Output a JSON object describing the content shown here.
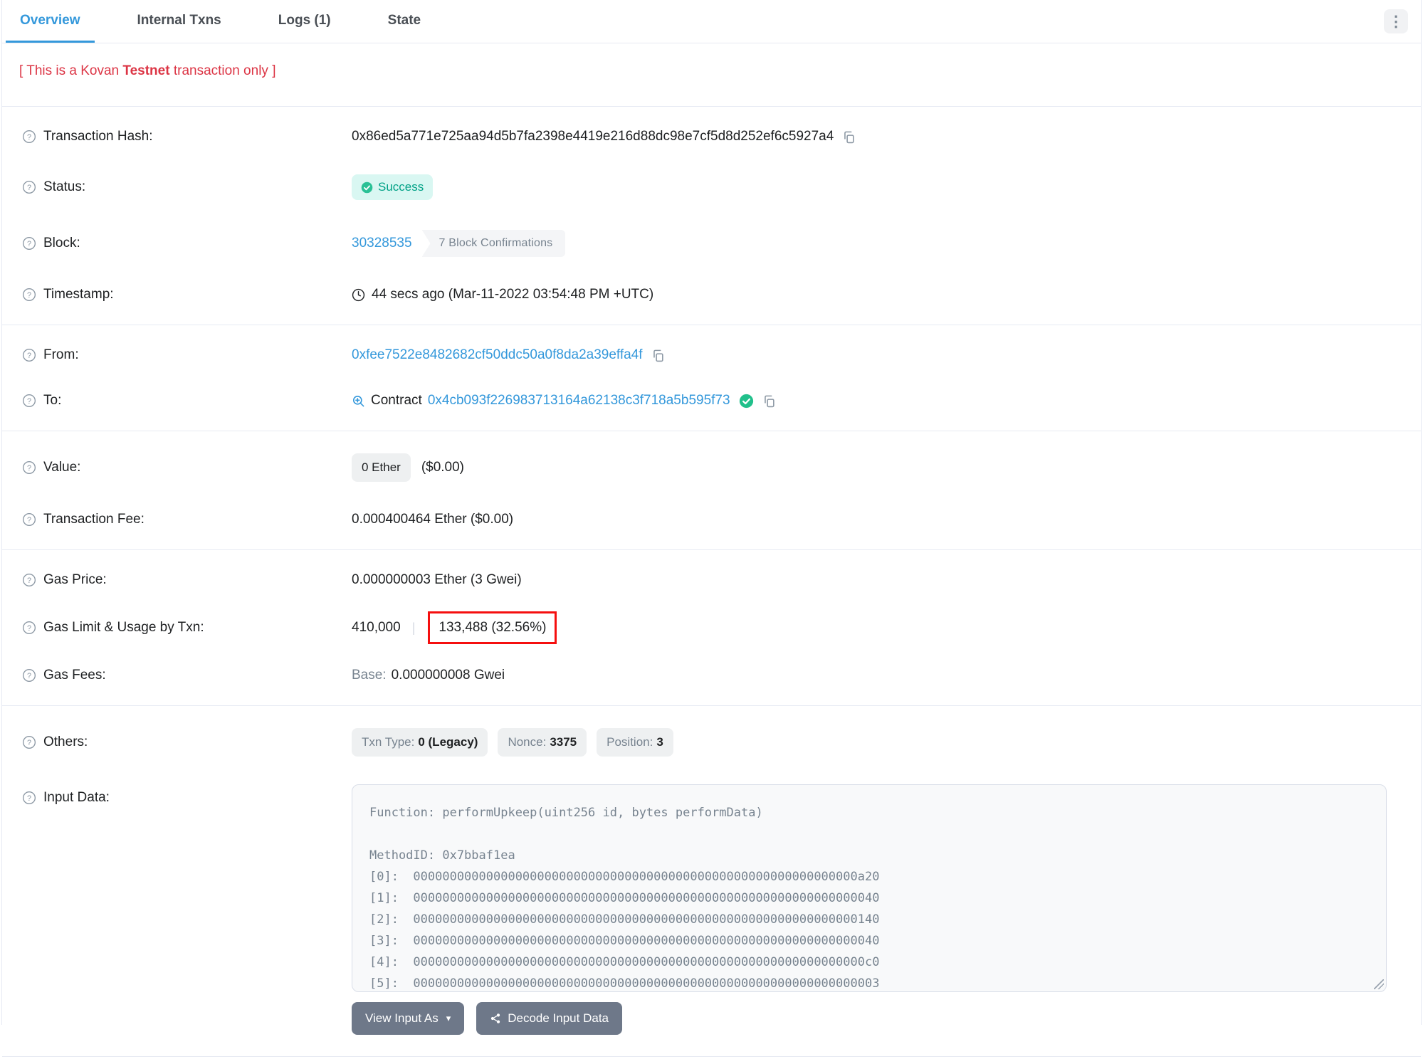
{
  "tabs": {
    "items": [
      {
        "label": "Overview",
        "active": true
      },
      {
        "label": "Internal Txns",
        "active": false
      },
      {
        "label": "Logs (1)",
        "active": false
      },
      {
        "label": "State",
        "active": false
      }
    ],
    "menu_glyph": "⋮"
  },
  "notice": {
    "prefix": "[ This is a Kovan ",
    "bold": "Testnet",
    "suffix": " transaction only ]"
  },
  "rows": {
    "transaction_hash": {
      "label": "Transaction Hash:",
      "value": "0x86ed5a771e725aa94d5b7fa2398e4419e216d88dc98e7cf5d8d252ef6c5927a4"
    },
    "status": {
      "label": "Status:",
      "value": "Success"
    },
    "block": {
      "label": "Block:",
      "number": "30328535",
      "confirmations": "7 Block Confirmations"
    },
    "timestamp": {
      "label": "Timestamp:",
      "value": "44 secs ago (Mar-11-2022 03:54:48 PM +UTC)"
    },
    "from": {
      "label": "From:",
      "address": "0xfee7522e8482682cf50ddc50a0f8da2a39effa4f"
    },
    "to": {
      "label": "To:",
      "type": "Contract",
      "address": "0x4cb093f226983713164a62138c3f718a5b595f73"
    },
    "value": {
      "label": "Value:",
      "amount": "0 Ether",
      "usd": "($0.00)"
    },
    "transaction_fee": {
      "label": "Transaction Fee:",
      "value": "0.000400464 Ether ($0.00)"
    },
    "gas_price": {
      "label": "Gas Price:",
      "value": "0.000000003 Ether (3 Gwei)"
    },
    "gas_limit_usage": {
      "label": "Gas Limit & Usage by Txn:",
      "limit": "410,000",
      "separator": "|",
      "usage": "133,488 (32.56%)"
    },
    "gas_fees": {
      "label": "Gas Fees:",
      "base_label": "Base:",
      "base_value": "0.000000008 Gwei"
    },
    "others": {
      "label": "Others:",
      "badges": [
        {
          "label": "Txn Type:",
          "value": "0 (Legacy)"
        },
        {
          "label": "Nonce:",
          "value": "3375"
        },
        {
          "label": "Position:",
          "value": "3"
        }
      ]
    },
    "input_data": {
      "label": "Input Data:",
      "lines": [
        "Function: performUpkeep(uint256 id, bytes performData)",
        "",
        "MethodID: 0x7bbaf1ea",
        "[0]:  0000000000000000000000000000000000000000000000000000000000000a20",
        "[1]:  0000000000000000000000000000000000000000000000000000000000000040",
        "[2]:  0000000000000000000000000000000000000000000000000000000000000140",
        "[3]:  0000000000000000000000000000000000000000000000000000000000000040",
        "[4]:  00000000000000000000000000000000000000000000000000000000000000c0",
        "[5]:  0000000000000000000000000000000000000000000000000000000000000003"
      ]
    }
  },
  "buttons": {
    "view_input_as": "View Input As",
    "caret_glyph": "▾",
    "decode_input_data": "Decode Input Data"
  },
  "colors": {
    "accent_blue": "#3498db",
    "success_teal": "#00a186",
    "notice_red": "#dc3545",
    "annotation_red": "#f50f0f",
    "muted_gray": "#77838f",
    "divider": "#e7eaf3"
  },
  "icons": {
    "help": "question-circle-icon",
    "copy": "copy-icon",
    "clock": "clock-icon",
    "contract_lookup": "magnifier-plus-icon",
    "verified": "check-circle-icon",
    "menu": "kebab-menu-icon",
    "decode": "decode-icon"
  }
}
